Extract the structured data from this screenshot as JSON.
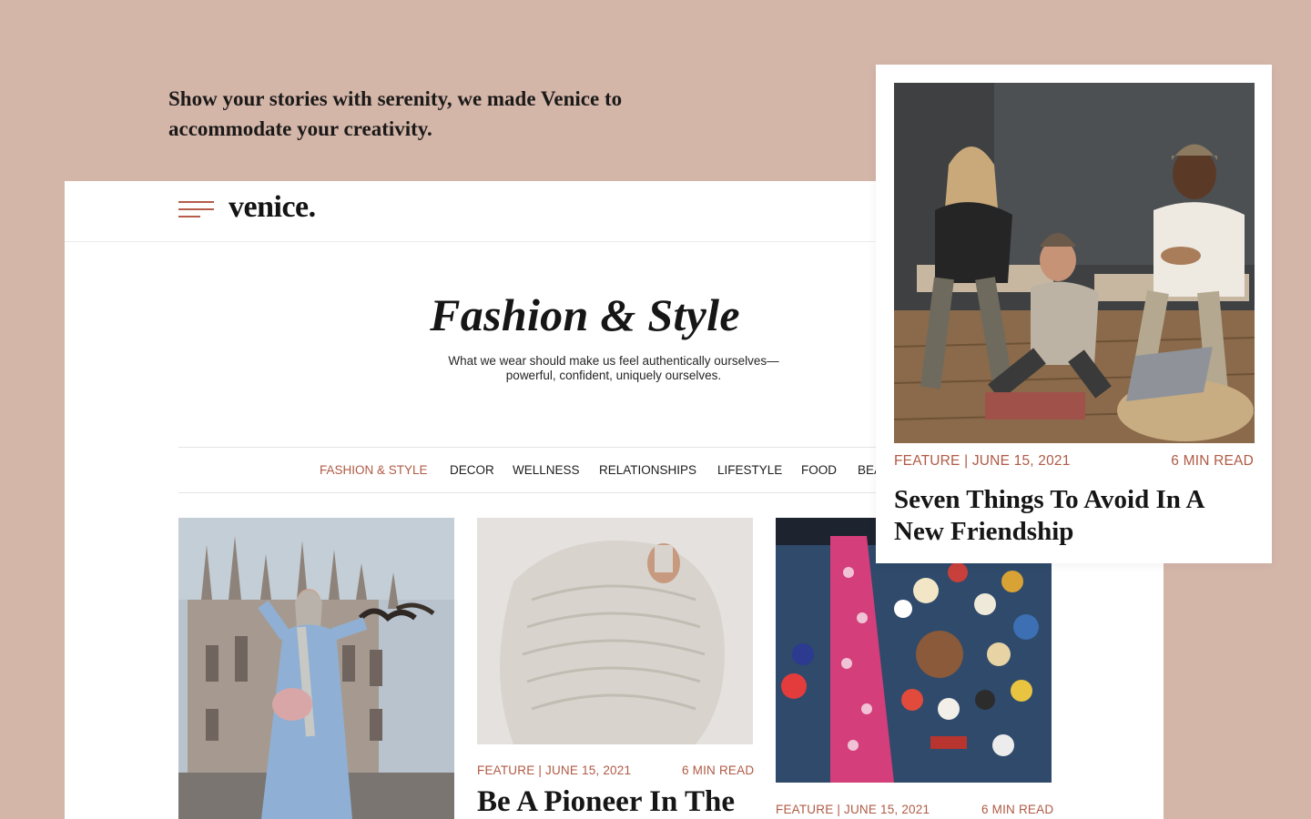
{
  "tagline": "Show your stories with serenity, we made Venice to accommodate your creativity.",
  "site": {
    "logo": "venice.",
    "page_title": "Fashion & Style",
    "page_description_line1": "What we wear should make us feel authentically ourselves—",
    "page_description_line2": "powerful, confident, uniquely ourselves.",
    "nav": [
      {
        "label": "FASHION & STYLE",
        "active": true
      },
      {
        "label": "DECOR",
        "active": false
      },
      {
        "label": "WELLNESS",
        "active": false
      },
      {
        "label": "RELATIONSHIPS",
        "active": false
      },
      {
        "label": "LIFESTYLE",
        "active": false
      },
      {
        "label": "FOOD",
        "active": false
      },
      {
        "label": "BEA",
        "active": false
      }
    ],
    "cards": [
      {
        "image": "woman-blue-coat-cathedral-photo"
      },
      {
        "image": "white-knit-sweater-photo",
        "category": "FEATURE",
        "date": "JUNE 15, 2021",
        "read_time": "6 MIN READ",
        "title": "Be A Pioneer In The"
      },
      {
        "image": "denim-jacket-pins-photo",
        "category": "FEATURE",
        "date": "JUNE 15, 2021",
        "read_time": "6 MIN READ"
      }
    ]
  },
  "featured": {
    "image": "friends-sitting-laughing-photo",
    "category": "FEATURE",
    "date": "JUNE 15, 2021",
    "read_time": "6 MIN READ",
    "title": "Seven Things To Avoid In A New Friendship"
  },
  "colors": {
    "background": "#d4b6a9",
    "accent": "#b05a45",
    "text": "#161616"
  }
}
